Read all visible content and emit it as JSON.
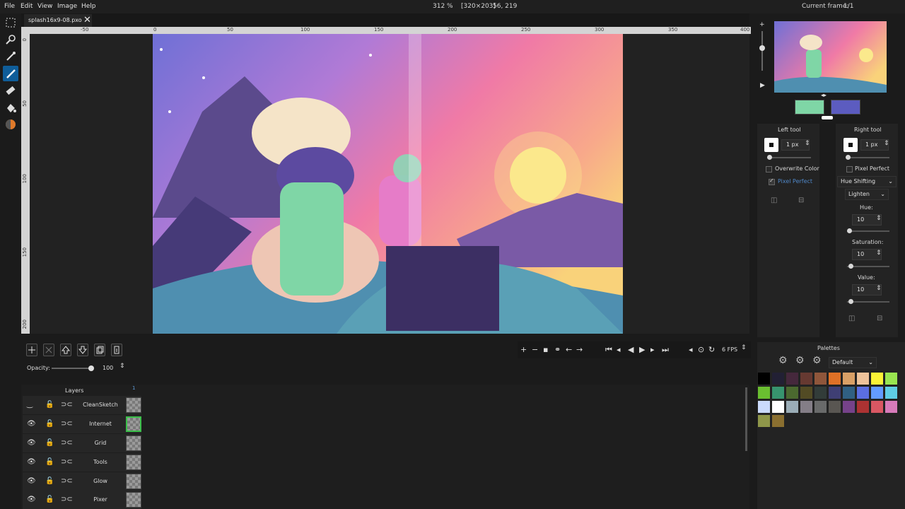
{
  "menu": {
    "items": [
      "File",
      "Edit",
      "View",
      "Image",
      "Help"
    ],
    "zoom": "312 %",
    "image_size": "[320×203]",
    "cursor_pos": "56, 219",
    "current_frame_label": "Current frame:",
    "current_frame_value": "1/1"
  },
  "tab": {
    "filename": "splash16x9-08.pxo",
    "close": "✕"
  },
  "rulers": {
    "h_labels": [
      "-50",
      "0",
      "50",
      "100",
      "150",
      "200",
      "250",
      "300",
      "350",
      "400"
    ],
    "v_labels": [
      "0",
      "50",
      "100",
      "150",
      "200"
    ]
  },
  "layer_controls": {
    "opacity_label": "Opacity:",
    "opacity_value": "100",
    "opacity_fraction": 1.0
  },
  "animation": {
    "fps": "6 FPS",
    "frame_number": "1"
  },
  "layers": {
    "header": "Layers",
    "items": [
      {
        "name": "CleanSketch",
        "visible": false
      },
      {
        "name": "Internet",
        "visible": true
      },
      {
        "name": "Grid",
        "visible": true
      },
      {
        "name": "Tools",
        "visible": true
      },
      {
        "name": "Glow",
        "visible": true
      },
      {
        "name": "Pixer",
        "visible": true
      }
    ]
  },
  "colors": {
    "left_color": "#7fd6a6",
    "right_color": "#5c5cc0",
    "accent": "#0f5d99"
  },
  "left_tool": {
    "title": "Left tool",
    "brush_size": "1 px",
    "overwrite_color": "Overwrite Color",
    "pixel_perfect": "Pixel Perfect",
    "pixel_perfect_checked": true
  },
  "right_tool": {
    "title": "Right tool",
    "brush_size": "1 px",
    "pixel_perfect": "Pixel Perfect",
    "mode": "Hue Shifting",
    "blend": "Lighten",
    "hue_label": "Hue:",
    "hue_value": "10",
    "saturation_label": "Saturation:",
    "saturation_value": "10",
    "value_label": "Value:",
    "value_value": "10"
  },
  "palettes": {
    "title": "Palettes",
    "selected": "Default",
    "swatches": [
      "#000000",
      "#222034",
      "#45283c",
      "#663931",
      "#8f563b",
      "#df7126",
      "#d9a066",
      "#eec39a",
      "#fbf236",
      "#99e550",
      "#6abe30",
      "#37946e",
      "#4b692f",
      "#524b24",
      "#323c39",
      "#3f3f74",
      "#306082",
      "#5b6ee1",
      "#639bff",
      "#5fcde4",
      "#cbdbfc",
      "#ffffff",
      "#9badb7",
      "#847e87",
      "#696a6a",
      "#595652",
      "#76428a",
      "#ac3232",
      "#d95763",
      "#d77bba",
      "#8f974a",
      "#8a6f30"
    ]
  }
}
